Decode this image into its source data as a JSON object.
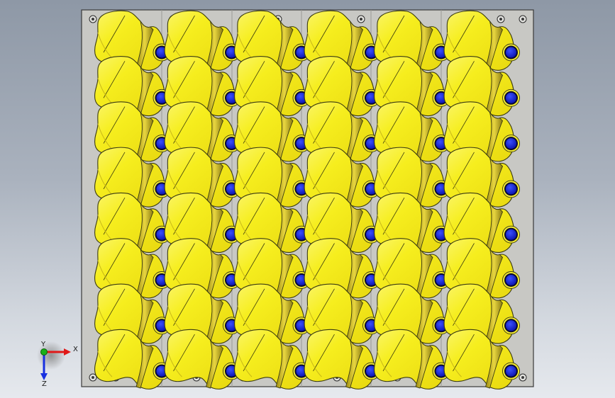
{
  "viewport": {
    "background_top": "#8e98a6",
    "background_bottom": "#e6e9ee"
  },
  "model": {
    "plate_color": "#c8c8c4",
    "part_color": "#f6ee1e",
    "part_edge_color": "#3a3a10",
    "part_side_color": "#c9b020",
    "pin_color": "#1a26d8",
    "pin_ring_color": "#0a0a30",
    "rows": 8,
    "cols": 6
  },
  "triad": {
    "x_label": "X",
    "y_label": "Y",
    "z_label": "Z",
    "x_color": "#e01818",
    "y_color": "#18b018",
    "z_color": "#1830e0"
  }
}
